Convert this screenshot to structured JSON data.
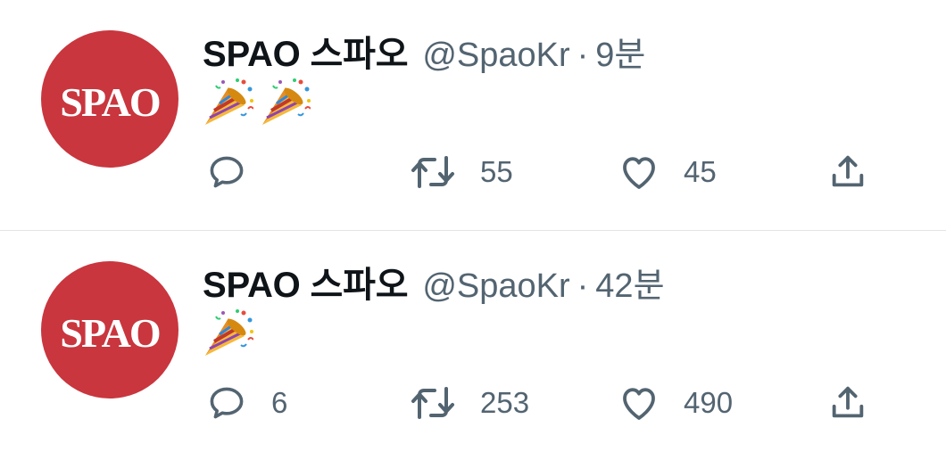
{
  "tweets": [
    {
      "display_name": "SPAO 스파오",
      "handle": "@SpaoKr",
      "separator": "·",
      "time": "9분",
      "avatar_text": "SPAO",
      "body_emoji_count": 2,
      "body_emoji": "party-popper-icon",
      "reply_count": "",
      "retweet_count": "55",
      "like_count": "45"
    },
    {
      "display_name": "SPAO 스파오",
      "handle": "@SpaoKr",
      "separator": "·",
      "time": "42분",
      "avatar_text": "SPAO",
      "body_emoji_count": 1,
      "body_emoji": "party-popper-icon",
      "reply_count": "6",
      "retweet_count": "253",
      "like_count": "490"
    }
  ],
  "colors": {
    "avatar_bg": "#c9363e",
    "name_text": "#0f1419",
    "secondary_text": "#536471",
    "divider": "#e1e5e8"
  }
}
